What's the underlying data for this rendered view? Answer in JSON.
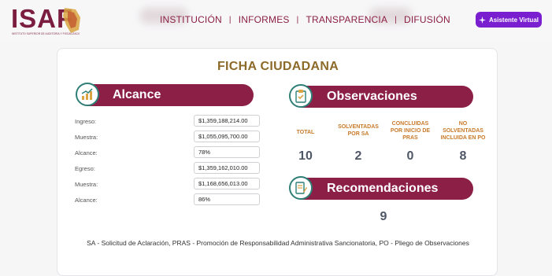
{
  "header": {
    "logo_text": "ISAF",
    "logo_subtitle": "INSTITUTO SUPERIOR DE AUDITORÍA Y FISCALIZACIÓN",
    "nav": [
      "INSTITUCIÓN",
      "INFORMES",
      "TRANSPARENCIA",
      "DIFUSIÓN"
    ],
    "assistant_label": "Asistente Virtual",
    "colors": {
      "brand": "#8b1f45",
      "assistant": "#7a1fd0"
    }
  },
  "card": {
    "title": "FICHA CIUDADANA",
    "alcance": {
      "heading": "Alcance",
      "rows": [
        {
          "label": "Ingreso:",
          "value": "$1,359,188,214.00"
        },
        {
          "label": "Muestra:",
          "value": "$1,055,095,700.00"
        },
        {
          "label": "Alcance:",
          "value": "78%"
        },
        {
          "label": "Egreso:",
          "value": "$1,359,162,010.00"
        },
        {
          "label": "Muestra:",
          "value": "$1,168,656,013.00"
        },
        {
          "label": "Alcance:",
          "value": "86%"
        }
      ]
    },
    "observaciones": {
      "heading": "Observaciones",
      "columns": [
        {
          "label": "TOTAL",
          "value": "10"
        },
        {
          "label": "SOLVENTADAS POR SA",
          "value": "2"
        },
        {
          "label": "CONCLUIDAS POR INICIO DE PRAS",
          "value": "0"
        },
        {
          "label": "NO SOLVENTADAS INCLUIDA EN PO",
          "value": "8"
        }
      ]
    },
    "recomendaciones": {
      "heading": "Recomendaciones",
      "value": "9"
    },
    "footnote": "SA - Solicitud de Aclaración, PRAS - Promoción de Responsabilidad Administrativa Sancionatoria, PO - Pliego de Observaciones"
  },
  "icons": [
    "chart-growth-icon",
    "clipboard-check-icon",
    "document-pen-icon",
    "sparkle-icon"
  ]
}
